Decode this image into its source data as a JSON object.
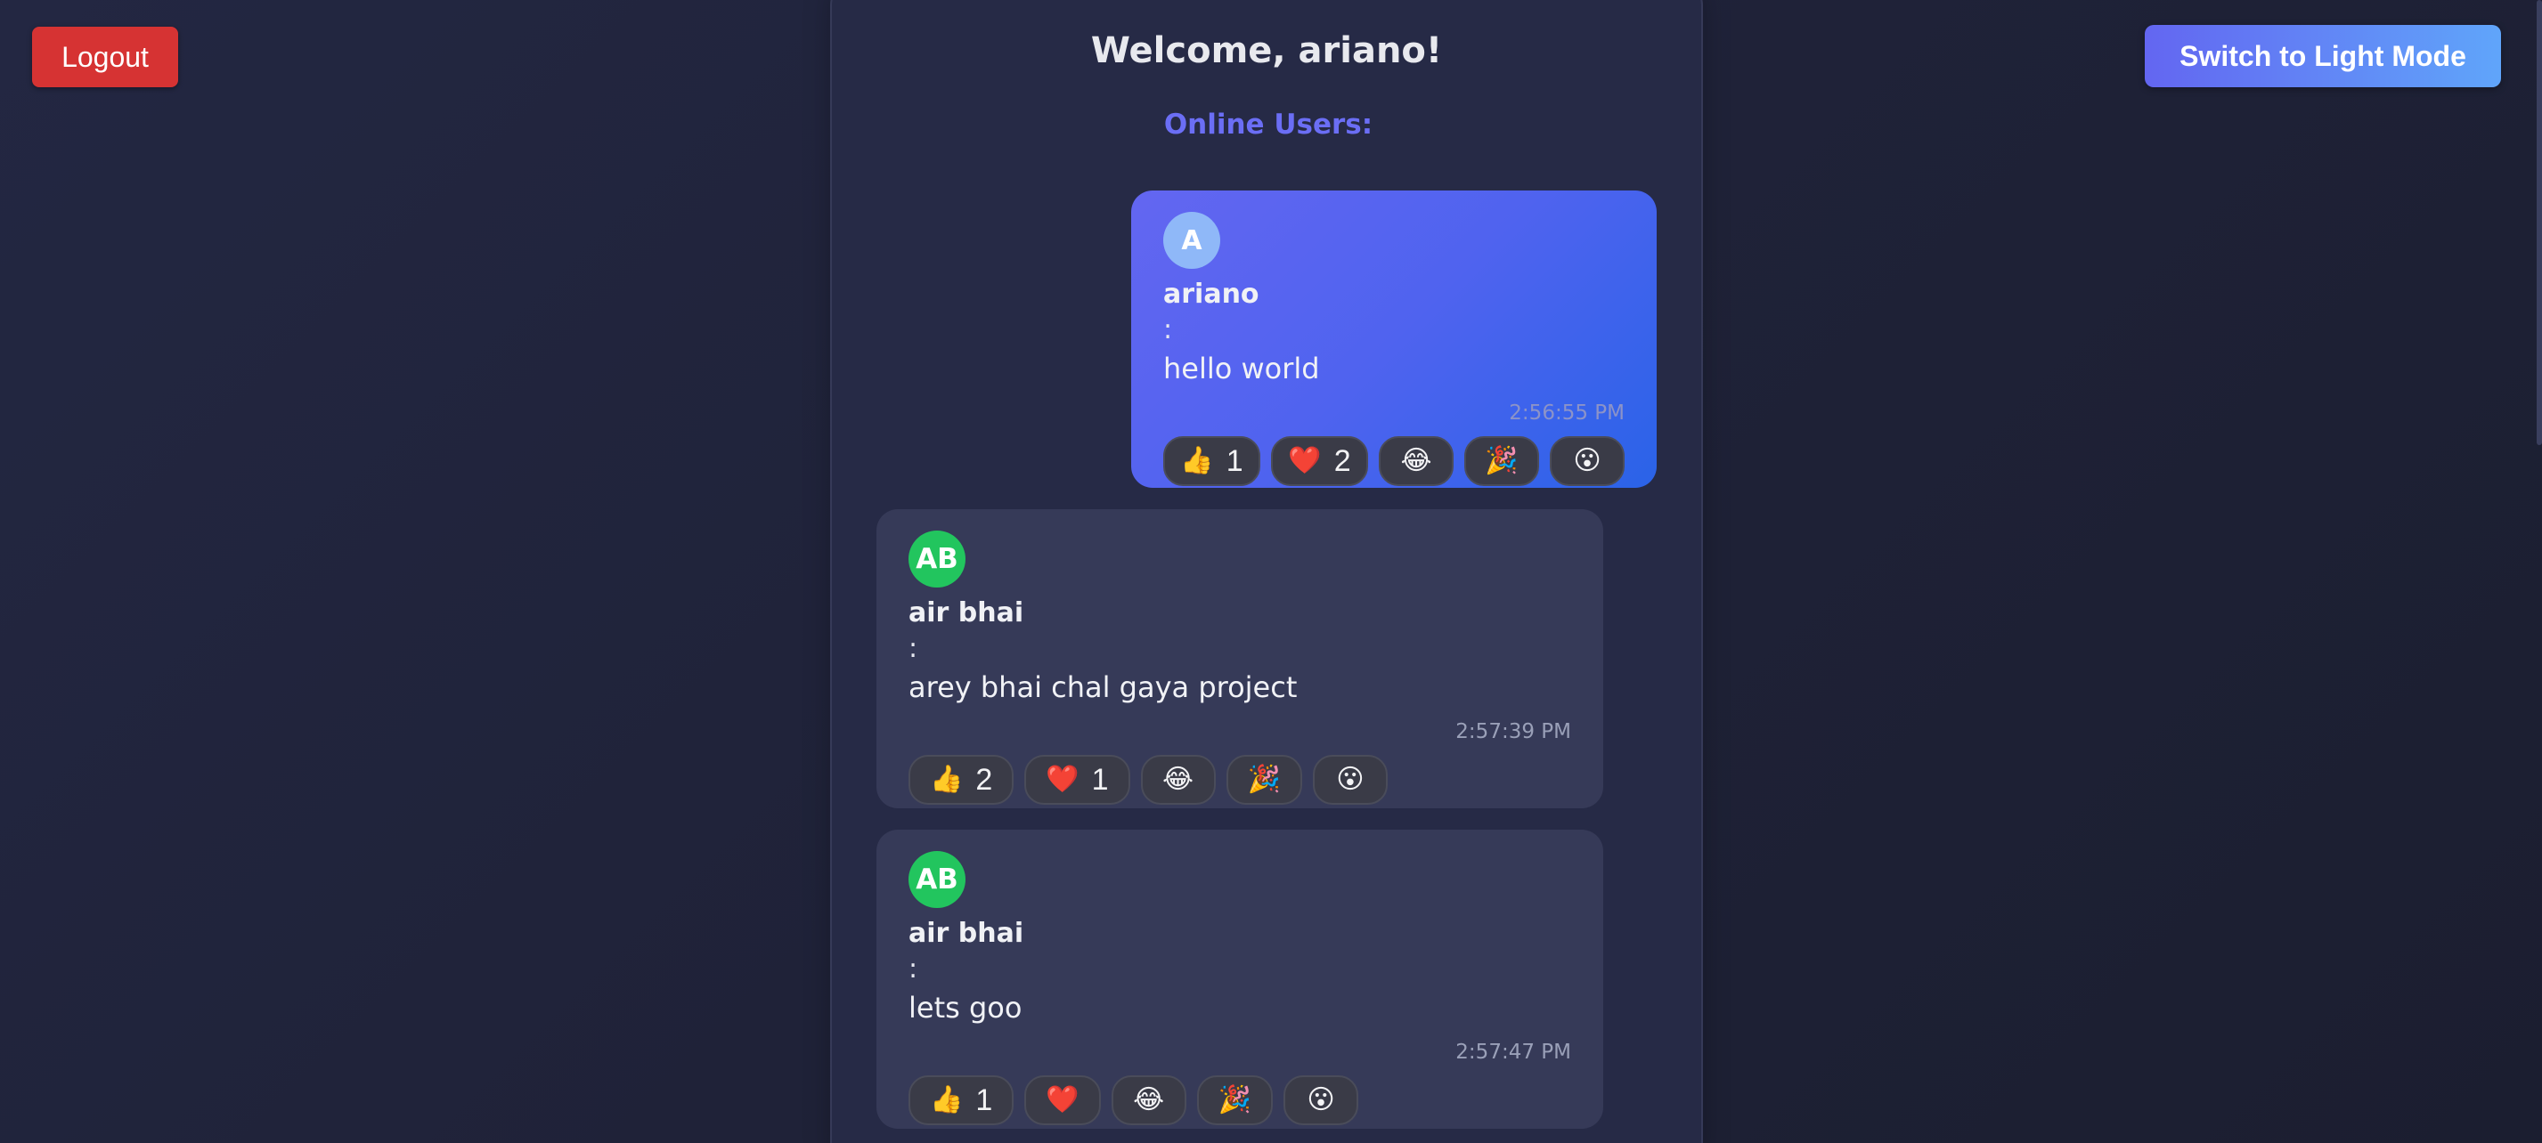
{
  "header": {
    "logout_label": "Logout",
    "theme_toggle_label": "Switch to Light Mode"
  },
  "chat": {
    "welcome": "Welcome, ariano!",
    "online_users_label": "Online Users:"
  },
  "messages": [
    {
      "avatar": "A",
      "sender": "ariano",
      "separator": ":",
      "text": "hello world",
      "time": "2:56:55 PM",
      "reactions": [
        {
          "icon": "thumbs-up-icon",
          "emoji": "👍",
          "count": "1"
        },
        {
          "icon": "heart-icon",
          "emoji": "❤️",
          "count": "2"
        },
        {
          "icon": "laughing-face-icon",
          "emoji": "😂",
          "count": ""
        },
        {
          "icon": "party-popper-icon",
          "emoji": "🎉",
          "count": ""
        },
        {
          "icon": "surprised-face-icon",
          "emoji": "😮",
          "count": ""
        }
      ]
    },
    {
      "avatar": "AB",
      "sender": "air bhai",
      "separator": ":",
      "text": "arey bhai chal gaya project",
      "time": "2:57:39 PM",
      "reactions": [
        {
          "icon": "thumbs-up-icon",
          "emoji": "👍",
          "count": "2"
        },
        {
          "icon": "heart-icon",
          "emoji": "❤️",
          "count": "1"
        },
        {
          "icon": "laughing-face-icon",
          "emoji": "😂",
          "count": ""
        },
        {
          "icon": "party-popper-icon",
          "emoji": "🎉",
          "count": ""
        },
        {
          "icon": "surprised-face-icon",
          "emoji": "😮",
          "count": ""
        }
      ]
    },
    {
      "avatar": "AB",
      "sender": "air bhai",
      "separator": ":",
      "text": "lets goo",
      "time": "2:57:47 PM",
      "reactions": [
        {
          "icon": "thumbs-up-icon",
          "emoji": "👍",
          "count": "1"
        },
        {
          "icon": "heart-icon",
          "emoji": "❤️",
          "count": ""
        },
        {
          "icon": "laughing-face-icon",
          "emoji": "😂",
          "count": ""
        },
        {
          "icon": "party-popper-icon",
          "emoji": "🎉",
          "count": ""
        },
        {
          "icon": "surprised-face-icon",
          "emoji": "😮",
          "count": ""
        }
      ]
    }
  ],
  "colors": {
    "background": "#1f2238",
    "panel": "#262a46",
    "logout": "#d63333",
    "accent": "#6366f1",
    "own_bubble_end": "#2a63e8",
    "other_bubble": "#363a58",
    "avatar_other": "#22c55e",
    "avatar_own": "#8fb8f8"
  }
}
